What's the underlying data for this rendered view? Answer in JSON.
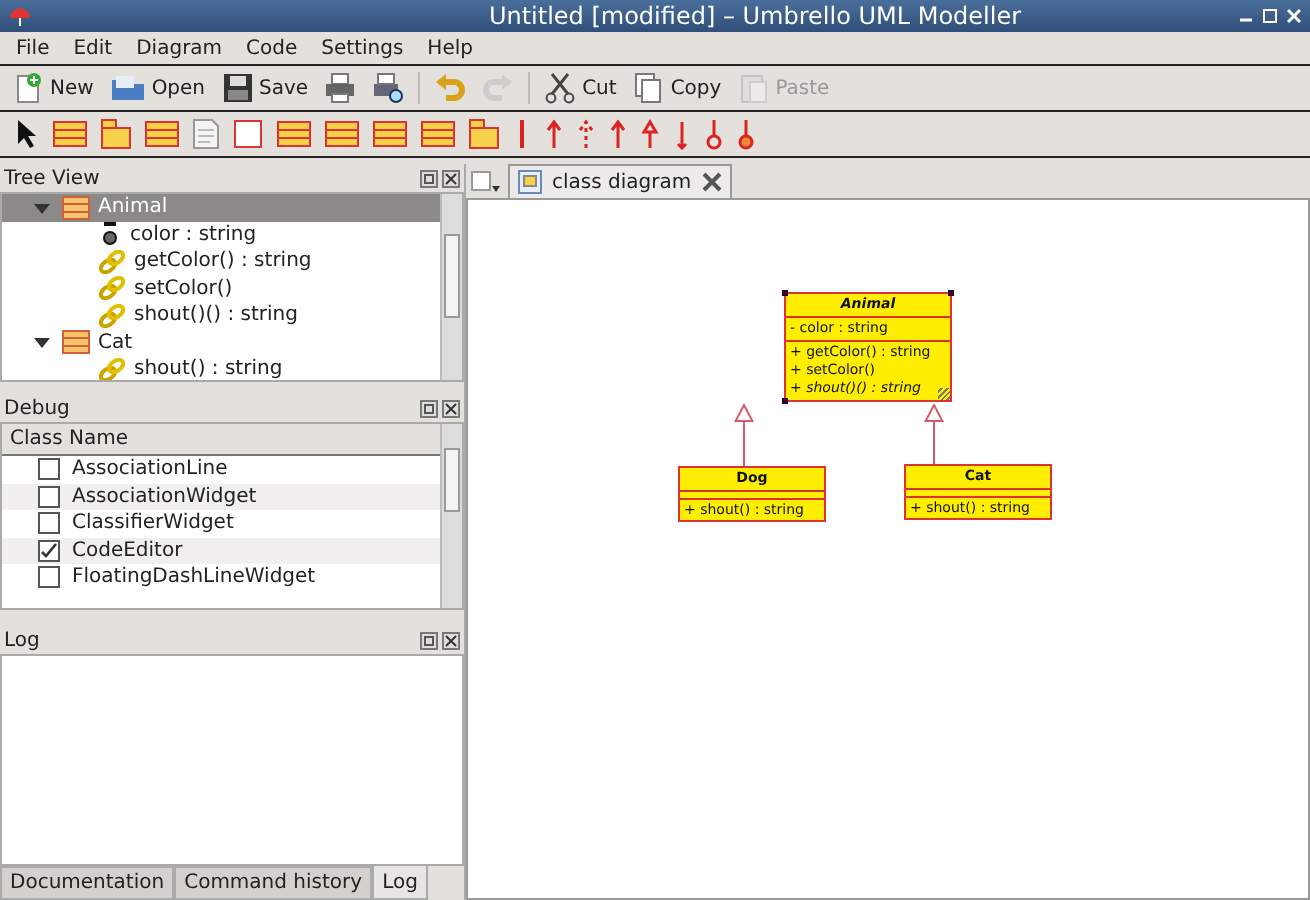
{
  "window": {
    "title": "Untitled [modified] – Umbrello UML Modeller"
  },
  "menu": [
    "File",
    "Edit",
    "Diagram",
    "Code",
    "Settings",
    "Help"
  ],
  "toolbar": [
    {
      "kind": "new",
      "label": "New",
      "disabled": false
    },
    {
      "kind": "open",
      "label": "Open",
      "disabled": false
    },
    {
      "kind": "save",
      "label": "Save",
      "disabled": false
    },
    {
      "kind": "print",
      "disabled": false
    },
    {
      "kind": "preview",
      "disabled": false
    },
    {
      "kind": "undo",
      "disabled": false
    },
    {
      "kind": "redo",
      "disabled": true
    },
    {
      "kind": "cut",
      "label": "Cut",
      "disabled": false
    },
    {
      "kind": "copy",
      "label": "Copy",
      "disabled": false
    },
    {
      "kind": "paste",
      "label": "Paste",
      "disabled": true
    }
  ],
  "tree_view": {
    "title": "Tree View",
    "items": [
      {
        "kind": "class",
        "label": "Animal",
        "expanded": true,
        "selected": true,
        "children": [
          {
            "kind": "attribute",
            "label": "color : string",
            "selected": false
          },
          {
            "kind": "operation",
            "label": "getColor() : string",
            "selected": false
          },
          {
            "kind": "operation",
            "label": "setColor()",
            "selected": false
          },
          {
            "kind": "operation",
            "label": "shout()() : string",
            "selected": false
          }
        ]
      },
      {
        "kind": "class",
        "label": "Cat",
        "expanded": true,
        "selected": false,
        "children": [
          {
            "kind": "operation",
            "label": "shout() : string",
            "selected": false
          }
        ]
      }
    ]
  },
  "debug": {
    "title": "Debug",
    "column": "Class Name",
    "rows": [
      {
        "name": "AssociationLine",
        "checked": false
      },
      {
        "name": "AssociationWidget",
        "checked": false
      },
      {
        "name": "ClassifierWidget",
        "checked": false
      },
      {
        "name": "CodeEditor",
        "checked": true
      },
      {
        "name": "FloatingDashLineWidget",
        "checked": false
      }
    ]
  },
  "log": {
    "title": "Log"
  },
  "bottom_tabs": [
    {
      "label": "Documentation",
      "selected": false
    },
    {
      "label": "Command history",
      "selected": false
    },
    {
      "label": "Log",
      "selected": true
    }
  ],
  "diagram_tabs": [
    {
      "label": "class diagram",
      "selected": true
    }
  ],
  "diagram": {
    "classes": [
      {
        "name": "Animal",
        "abstract": true,
        "selected": true,
        "attributes": [
          "- color : string"
        ],
        "operations": [
          {
            "label": "+ getColor() : string",
            "abstract": false
          },
          {
            "label": "+ setColor()",
            "abstract": false
          },
          {
            "label": "+ shout()() : string",
            "abstract": true
          }
        ]
      },
      {
        "name": "Dog",
        "abstract": false,
        "selected": false,
        "generalizes": true,
        "operations": [
          {
            "label": "+ shout() : string",
            "abstract": false
          }
        ]
      },
      {
        "name": "Cat",
        "abstract": false,
        "selected": false,
        "generalizes": true,
        "operations": [
          {
            "label": "+ shout() : string",
            "abstract": false
          }
        ]
      }
    ]
  }
}
